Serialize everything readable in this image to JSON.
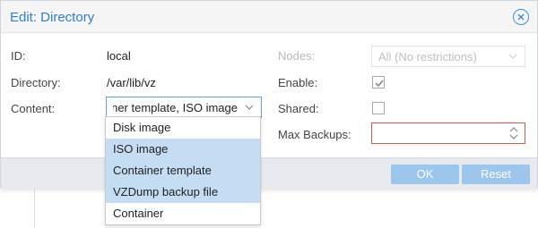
{
  "dialog": {
    "title": "Edit: Directory"
  },
  "form": {
    "id_label": "ID:",
    "id_value": "local",
    "directory_label": "Directory:",
    "directory_value": "/var/lib/vz",
    "content_label": "Content:",
    "content_value": "Container template, ISO image",
    "nodes_label": "Nodes:",
    "nodes_value": "All (No restrictions)",
    "enable_label": "Enable:",
    "enable_checked": true,
    "shared_label": "Shared:",
    "shared_checked": false,
    "max_backups_label": "Max Backups:",
    "max_backups_value": ""
  },
  "content_dropdown": {
    "options": [
      {
        "label": "Disk image",
        "selected": false
      },
      {
        "label": "ISO image",
        "selected": true
      },
      {
        "label": "Container template",
        "selected": true
      },
      {
        "label": "VZDump backup file",
        "selected": true
      },
      {
        "label": "Container",
        "selected": false
      }
    ]
  },
  "footer": {
    "ok_label": "OK",
    "reset_label": "Reset"
  },
  "colors": {
    "accent": "#2f7fcf",
    "selected_option": "#c5ddf3",
    "button": "#9dc6ec",
    "invalid_border": "#d55a4c"
  },
  "icons": {
    "close": "close-circle-icon",
    "dropdown": "chevron-down-icon",
    "check": "check-icon",
    "spinner": "spinner-up-down-icon"
  }
}
